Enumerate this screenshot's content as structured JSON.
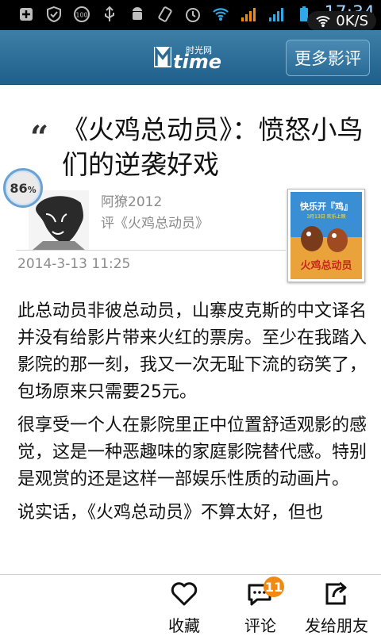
{
  "status_bar": {
    "icons": [
      "add-notification-icon",
      "shield-icon",
      "battery-saver-100-icon",
      "usb-icon",
      "android-icon",
      "rotate-icon",
      "alarm-icon",
      "wifi-icon",
      "signal-orange-icon",
      "signal-icon",
      "battery-icon"
    ],
    "time": "17:34",
    "speed": "0K/S"
  },
  "header": {
    "logo_cn": "时光网",
    "logo_text": "time",
    "more_reviews": "更多影评"
  },
  "article": {
    "title": "《火鸡总动员》：愤怒小鸟们的逆袭好戏",
    "rating": "86",
    "rating_unit": "%",
    "author": "阿獠2012",
    "review_of": "评《火鸡总动员》",
    "date": "2014-3-13 11:25",
    "paragraphs": [
      "此总动员非彼总动员，山寨皮克斯的中文译名并没有给影片带来火红的票房。至少在我踏入影院的那一刻，我又一次无耻下流的窃笑了，包场原来只需要25元。",
      "很享受一个人在影院里正中位置舒适观影的感觉，这是一种恶趣味的家庭影院替代感。特别是观赏的还是这样一部娱乐性质的动画片。",
      "说实话，《火鸡总动员》不算太好，但也"
    ],
    "poster_text_top": "快乐开『鸡』",
    "poster_text_sub": "3月13日 欢乐上映",
    "poster_text_title": "火鸡总动员"
  },
  "bottom_bar": {
    "favorite": "收藏",
    "comment": "评论",
    "comment_count": "11",
    "share": "发给朋友"
  },
  "colors": {
    "header_blue": "#2a6b96",
    "badge_orange": "#f08a12",
    "text_gray": "#8b8b8b"
  }
}
